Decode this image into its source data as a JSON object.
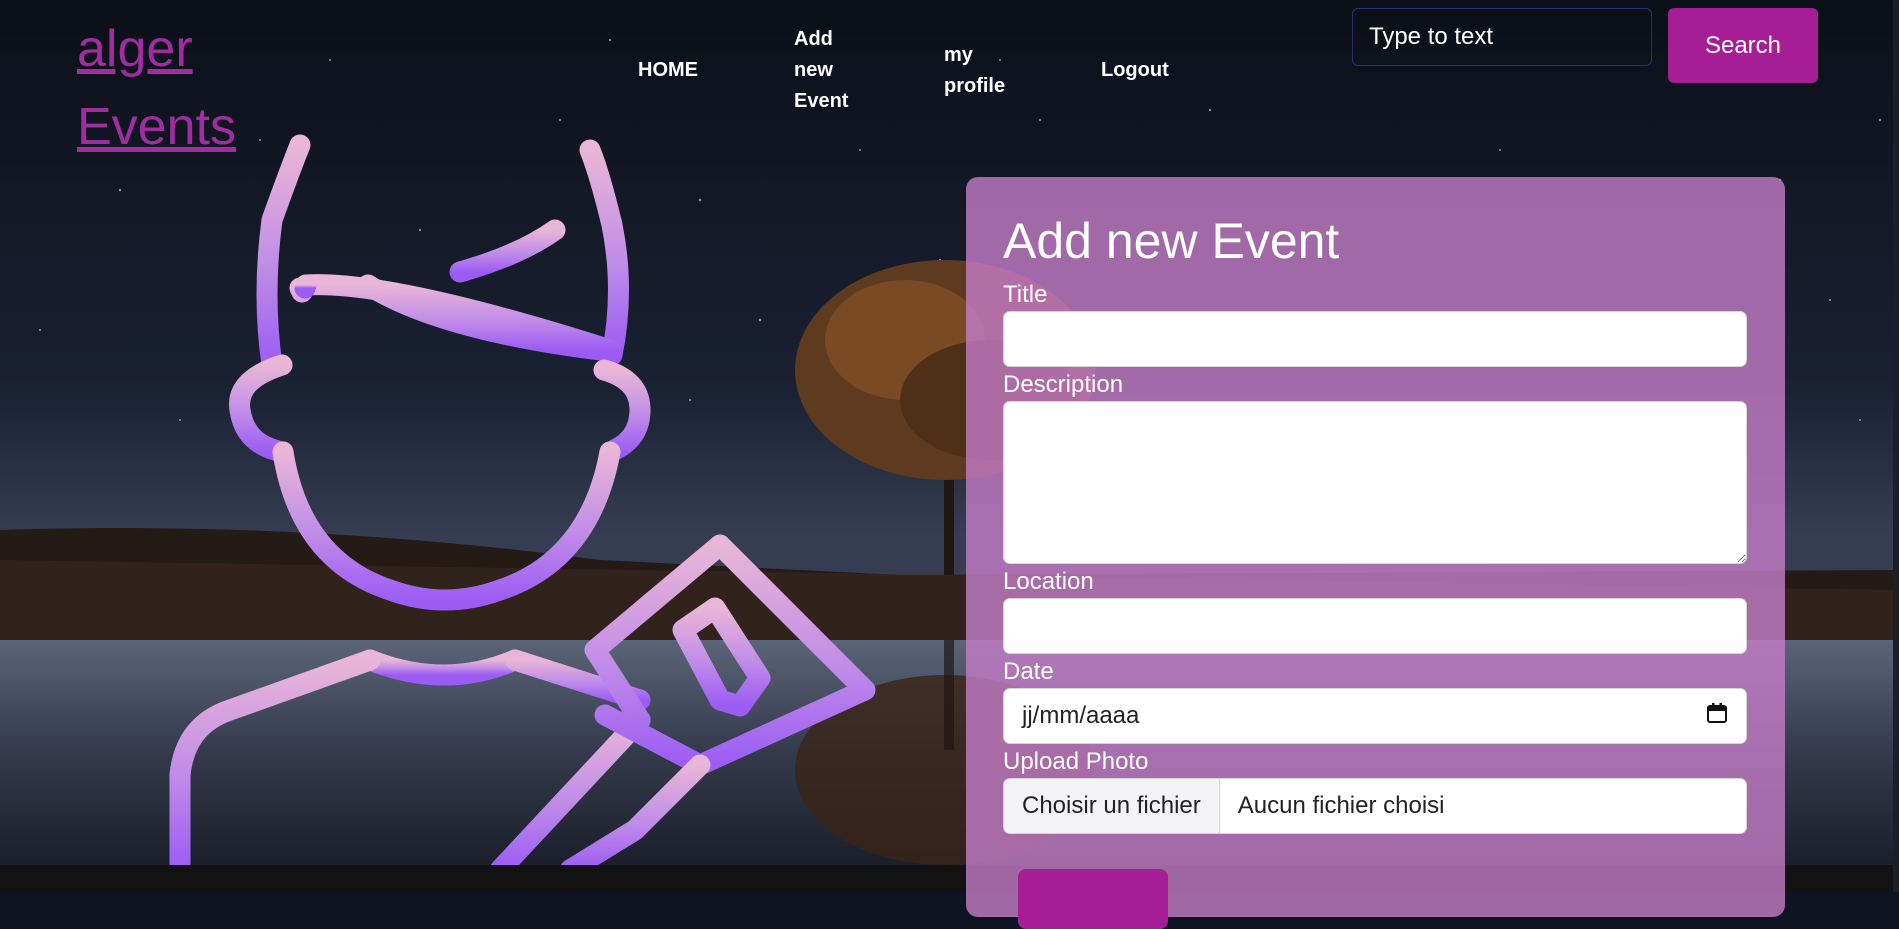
{
  "header": {
    "brand_line1": "alger",
    "brand_line2": "Events",
    "nav": {
      "home": "HOME",
      "add_event_line1": "Add",
      "add_event_line2": "new",
      "add_event_line3": "Event",
      "profile_line1": "my",
      "profile_line2": "profile",
      "logout": "Logout"
    },
    "search": {
      "placeholder": "Type to text",
      "button_label": "Search"
    }
  },
  "form": {
    "heading": "Add new Event",
    "title_label": "Title",
    "title_value": "",
    "description_label": "Description",
    "description_value": "",
    "location_label": "Location",
    "location_value": "",
    "date_label": "Date",
    "date_placeholder": "jj/mm/aaaa",
    "photo_label": "Upload Photo",
    "file_button_label": "Choisir un fichier",
    "file_status": "Aucun fichier choisi"
  },
  "colors": {
    "brand": "#a12ca1",
    "accent_button": "#a51e96",
    "card_background": "#c67dc8",
    "illustration_gradient_top": "#e9b6d8",
    "illustration_gradient_bottom": "#9c5cf4"
  },
  "icons": {
    "illustration": "user-with-megaphone-icon",
    "calendar": "calendar-icon"
  }
}
